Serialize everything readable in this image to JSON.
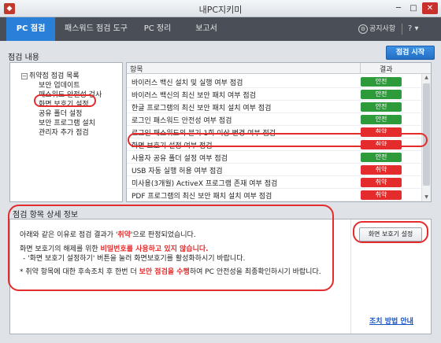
{
  "window": {
    "title": "내PC지키미",
    "minimize": "─",
    "maximize": "□",
    "close": "✕"
  },
  "tabs": [
    {
      "label": "PC 점검",
      "active": true
    },
    {
      "label": "패스워드 점검 도구",
      "active": false
    },
    {
      "label": "PC 정리",
      "active": false
    },
    {
      "label": "보고서",
      "active": false
    }
  ],
  "header": {
    "notice": "공지사항",
    "help": "?",
    "help_caret": "▾"
  },
  "section": {
    "title": "점검 내용",
    "start_button": "점검 시작"
  },
  "tree": {
    "root": "취약점 점검 목록",
    "items": [
      "보안 업데이트",
      "패스워드 안전성 검사",
      "화면 보호기 설정",
      "공유 폴더 설정",
      "보안 프로그램 설치",
      "관리자 추가 점검"
    ]
  },
  "table": {
    "headers": {
      "item": "항목",
      "result": "결과"
    },
    "rows": [
      {
        "item": "바이러스 백신 설치 및 실행 여부 점검",
        "result": "안전",
        "status": "safe"
      },
      {
        "item": "바이러스 백신의 최신 보안 패치 여부 점검",
        "result": "안전",
        "status": "safe"
      },
      {
        "item": "한글 프로그램의 최신 보안 패치 설치 여부 점검",
        "result": "안전",
        "status": "safe"
      },
      {
        "item": "로그인 패스워드 안전성 여부 점검",
        "result": "안전",
        "status": "safe"
      },
      {
        "item": "로그인 패스워드의 분기 1회 이상 변경 여부 점검",
        "result": "취약",
        "status": "weak"
      },
      {
        "item": "화면 보호기 설정 여부 점검",
        "result": "취약",
        "status": "weak"
      },
      {
        "item": "사용자 공유 폴더 설정 여부 점검",
        "result": "안전",
        "status": "safe"
      },
      {
        "item": "USB 자동 실행 허용 여부 점검",
        "result": "취약",
        "status": "weak"
      },
      {
        "item": "미사용(3개월) ActiveX 프로그램 존재 여부 점검",
        "result": "취약",
        "status": "weak"
      },
      {
        "item": "PDF 프로그램의 최신 보안 패치 설치 여부 점검",
        "result": "취약",
        "status": "weak"
      }
    ]
  },
  "detail": {
    "title": "점검 항목 상세 정보",
    "line1_pre": "아래와 같은 이유로 점검 결과가 '",
    "line1_red": "취약",
    "line1_post": "'으로 판정되었습니다.",
    "line2_pre": "화면 보호기의 해제를 위한 ",
    "line2_red": "비밀번호를 사용하고 있지 않습니다.",
    "line3": "- '화면 보호기 설정하기' 버튼을 눌러 화면보호기를 활성화하시기 바랍니다.",
    "line4_pre": "* 취약 항목에 대한 후속조치 후 한번 더 ",
    "line4_red": "보안 점검을 수행",
    "line4_post": "하여 PC 안전성을 최종확인하시기 바랍니다.",
    "action_button": "화면 보호기 설정",
    "guide_link": "조치 방법 안내"
  },
  "colors": {
    "accent": "#2a80d8",
    "safe": "#2e9b3b",
    "weak": "#e42c2c",
    "annotation": "#e42c2c"
  }
}
